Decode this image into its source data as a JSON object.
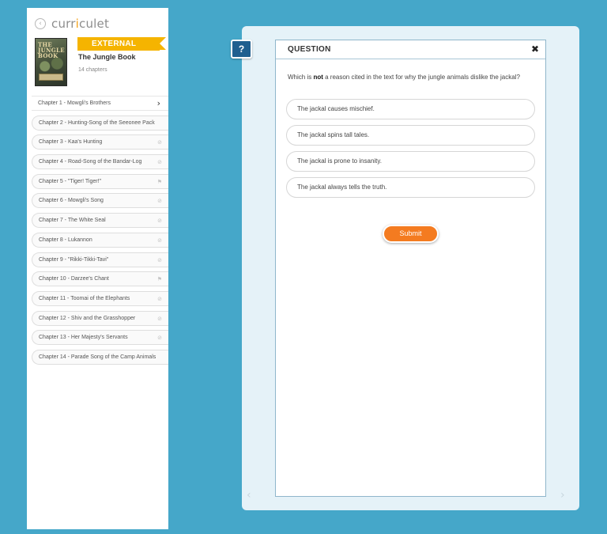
{
  "sidebar": {
    "back_icon": "chevron-left-icon",
    "logo": {
      "before": "curr",
      "accent": "i",
      "after": "culet"
    },
    "book": {
      "cover_title": "THE JUNGLE BOOK",
      "banner": "EXTERNAL",
      "title": "The Jungle Book",
      "chapter_count": "14 chapters"
    },
    "chapters": [
      {
        "label": "Chapter 1 - Mowgli's Brothers",
        "icon": "chevron-right-icon",
        "glyph": "›"
      },
      {
        "label": "Chapter 2 - Hunting-Song of the Seeonee Pack",
        "icon": "",
        "glyph": ""
      },
      {
        "label": "Chapter 3 - Kaa's Hunting",
        "icon": "lock-icon",
        "glyph": "⊘"
      },
      {
        "label": "Chapter 4 - Road-Song of the Bandar-Log",
        "icon": "lock-icon",
        "glyph": "⊘"
      },
      {
        "label": "Chapter 5 - \"Tiger! Tiger!\"",
        "icon": "flag-icon",
        "glyph": "⚑"
      },
      {
        "label": "Chapter 6 - Mowgli's Song",
        "icon": "lock-icon",
        "glyph": "⊘"
      },
      {
        "label": "Chapter 7 - The White Seal",
        "icon": "lock-icon",
        "glyph": "⊘"
      },
      {
        "label": "Chapter 8 - Lukannon",
        "icon": "lock-icon",
        "glyph": "⊘"
      },
      {
        "label": "Chapter 9 - \"Rikki-Tikki-Tavi\"",
        "icon": "lock-icon",
        "glyph": "⊘"
      },
      {
        "label": "Chapter 10 - Darzee's Chant",
        "icon": "flag-icon",
        "glyph": "⚑"
      },
      {
        "label": "Chapter 11 - Toomai of the Elephants",
        "icon": "lock-icon",
        "glyph": "⊘"
      },
      {
        "label": "Chapter 12 - Shiv and the Grasshopper",
        "icon": "lock-icon",
        "glyph": "⊘"
      },
      {
        "label": "Chapter 13 - Her Majesty's Servants",
        "icon": "lock-icon",
        "glyph": "⊘"
      },
      {
        "label": "Chapter 14 - Parade Song of the Camp Animals",
        "icon": "",
        "glyph": ""
      }
    ]
  },
  "main": {
    "help_label": "?",
    "question": {
      "header": "QUESTION",
      "close_glyph": "✖",
      "text_before": "Which is ",
      "text_bold": "not",
      "text_after": " a reason cited in the text for why the jungle animals dislike the jackal?",
      "options": [
        "The jackal causes mischief.",
        "The jackal spins tall tales.",
        "The jackal is prone to insanity.",
        "The jackal always tells the truth."
      ],
      "submit_label": "Submit"
    },
    "nav": {
      "prev_glyph": "‹",
      "next_glyph": "›"
    }
  },
  "colors": {
    "background": "#45a7c9",
    "banner": "#f5b400",
    "submit": "#f47b20",
    "help": "#1f5f8f",
    "panel": "#e5f2f8"
  }
}
